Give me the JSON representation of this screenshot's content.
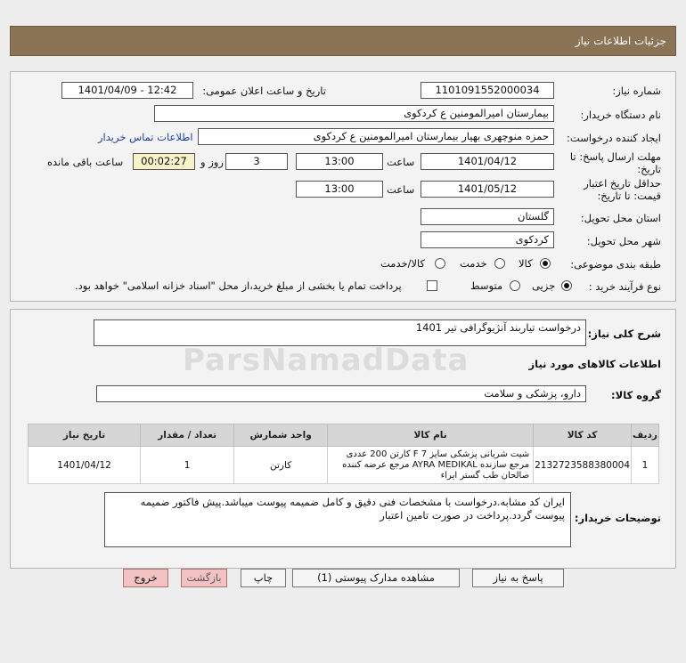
{
  "header": {
    "title": "جزئیات اطلاعات نیاز"
  },
  "form": {
    "need_number_label": "شماره نیاز:",
    "need_number": "1101091552000034",
    "announce_label": "تاریخ و ساعت اعلان عمومی:",
    "announce_value": "1401/04/09 - 12:42",
    "buyer_label": "نام دستگاه خریدار:",
    "buyer_value": "بیمارستان امیرالمومنین  ع  کردکوی",
    "creator_label": "ایجاد کننده درخواست:",
    "creator_value": "حمزه  منوچهری بهیار بیمارستان امیرالمومنین  ع  کردکوی",
    "contact_link": "اطلاعات تماس خریدار",
    "reply_deadline_label": "مهلت ارسال پاسخ: تا تاریخ:",
    "reply_date": "1401/04/12",
    "time_label": "ساعت",
    "reply_time": "13:00",
    "days_value": "3",
    "days_label": "روز و",
    "remaining_time": "00:02:27",
    "remaining_label": "ساعت باقی مانده",
    "validity_label": "حداقل تاریخ اعتبار قیمت: تا تاریخ:",
    "validity_date": "1401/05/12",
    "validity_time": "13:00",
    "province_label": "استان محل تحویل:",
    "province_value": "گلستان",
    "city_label": "شهر محل تحویل:",
    "city_value": "کردکوی",
    "category_label": "طبقه بندی موضوعی:",
    "category_options": [
      "کالا",
      "خدمت",
      "کالا/خدمت"
    ],
    "category_selected": "کالا",
    "process_label": "نوع فرآیند خرید :",
    "process_options": [
      "جزیی",
      "متوسط"
    ],
    "process_selected": "جزیی",
    "payment_note": "پرداخت تمام یا بخشی از مبلغ خرید،از محل \"اسناد خزانه اسلامی\" خواهد بود."
  },
  "summary": {
    "label": "شرح کلی نیاز:",
    "value": "درخواست تیاربند  آنژیوگرافی تیر 1401",
    "goods_info_title": "اطلاعات کالاهای مورد نیاز",
    "group_label": "گروه کالا:",
    "group_value": "دارو، پزشکی و سلامت"
  },
  "table": {
    "headers": [
      "ردیف",
      "کد کالا",
      "نام کالا",
      "واحد شمارش",
      "تعداد / مقدار",
      "تاریخ نیاز"
    ],
    "rows": [
      {
        "row": "1",
        "code": "2132723588380004",
        "name": "شیت شریانی پزشکی سایز F 7 کارتن 200 عددی مرجع سازنده AYRA MEDIKAL مرجع عرضه کننده صالحان طب گستر ایراء",
        "unit": "کارتن",
        "qty": "1",
        "date": "1401/04/12"
      }
    ]
  },
  "notes": {
    "label": "توضیحات خریدار:",
    "value": "ایران کد مشابه.درخواست با مشخصات فنی دقیق و کامل ضمیمه پیوست میباشد.پیش فاکتور ضمیمه پیوست گردد.پرداخت در صورت تامین اعتبار"
  },
  "buttons": {
    "reply": "پاسخ به نیاز",
    "attachments": "مشاهده مدارک پیوستی (1)",
    "print": "چاپ",
    "back": "بازگشت",
    "exit": "خروج"
  },
  "watermark": "ParsNamadData"
}
